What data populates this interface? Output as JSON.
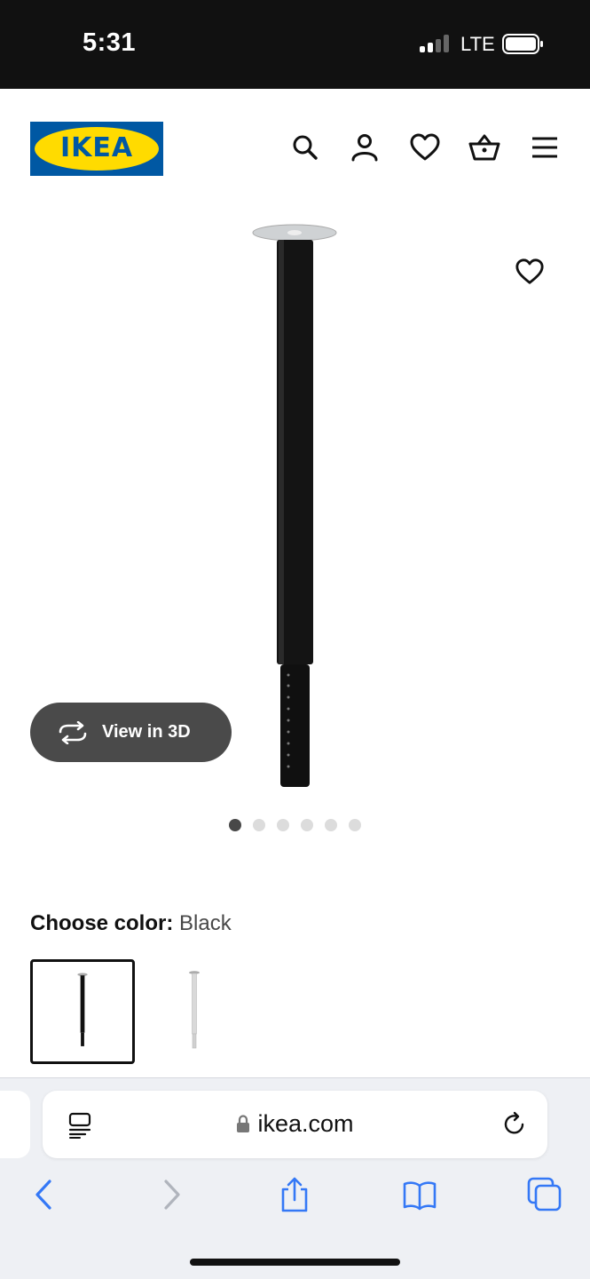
{
  "status": {
    "time": "5:31",
    "network": "LTE"
  },
  "header": {
    "logo_text": "IKEA",
    "icons": [
      "search-icon",
      "user-icon",
      "heart-icon",
      "basket-icon",
      "menu-icon"
    ]
  },
  "product": {
    "view3d_label": "View in 3D",
    "image_count": 6,
    "active_image": 1
  },
  "color": {
    "label": "Choose color:",
    "value": "Black",
    "options": [
      "Black",
      "White"
    ]
  },
  "browser": {
    "url": "ikea.com"
  },
  "colors": {
    "ikea_blue": "#0058a3",
    "ikea_yellow": "#ffdb00",
    "safari_blue": "#3478f6"
  }
}
